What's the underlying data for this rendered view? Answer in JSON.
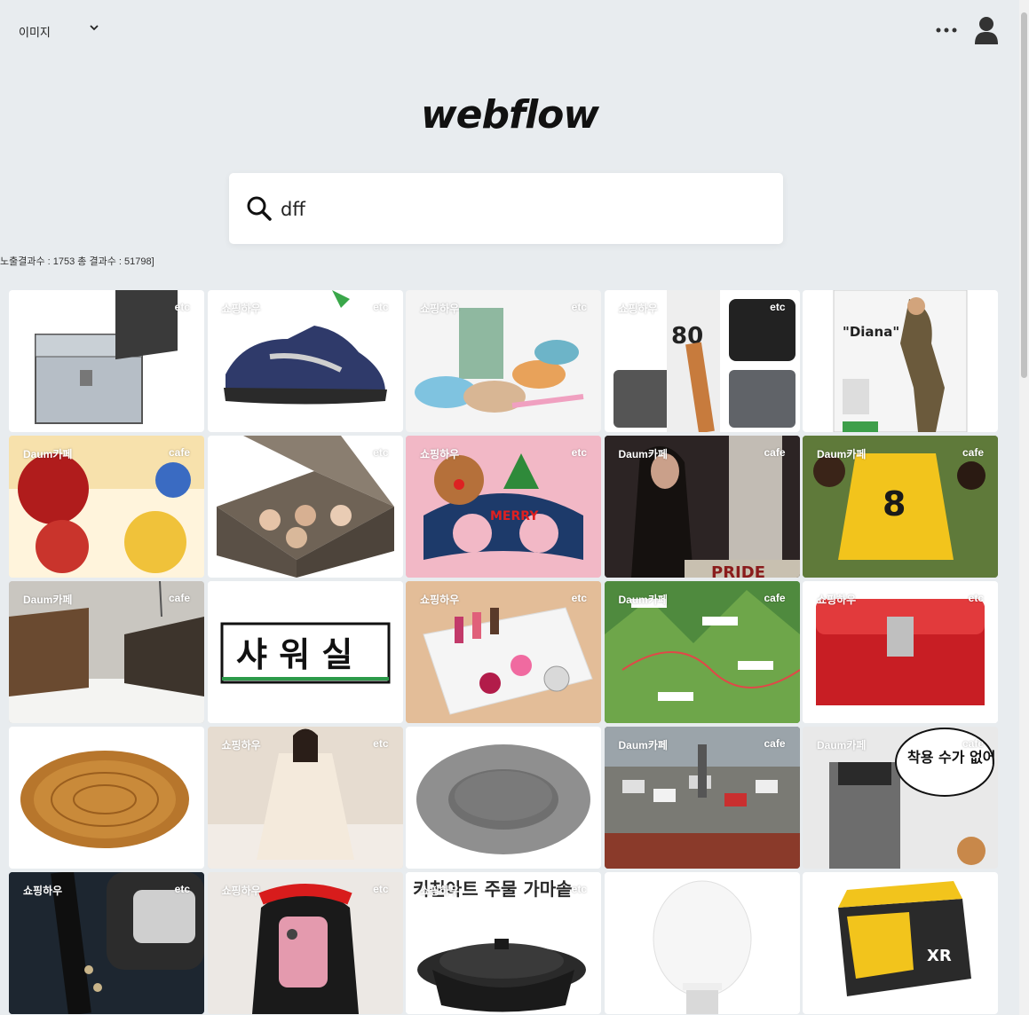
{
  "header": {
    "type_selector": "이미지",
    "more_label": "•••"
  },
  "logo": "webflow",
  "search": {
    "value": "dff"
  },
  "result_count": "노출결과수 : 1753 총 결과수 : 51798]",
  "results": [
    {
      "source": "",
      "type": "etc",
      "icon": "aluminum-case",
      "bg": "#ffffff"
    },
    {
      "source": "쇼핑하우",
      "type": "etc",
      "icon": "sneaker",
      "bg": "#ffffff"
    },
    {
      "source": "쇼핑하우",
      "type": "etc",
      "icon": "bowls",
      "bg": "#f4f4f4"
    },
    {
      "source": "쇼핑하우",
      "type": "etc",
      "icon": "bags",
      "bg": "#ffffff"
    },
    {
      "source": "",
      "type": "",
      "icon": "figure-diana",
      "bg": "#ffffff"
    },
    {
      "source": "Daum카페",
      "type": "cafe",
      "icon": "pouches",
      "bg": "#fff4dc"
    },
    {
      "source": "",
      "type": "etc",
      "icon": "storage-box",
      "bg": "#ffffff"
    },
    {
      "source": "쇼핑하우",
      "type": "etc",
      "icon": "christmas-glasses",
      "bg": "#f2b8c6"
    },
    {
      "source": "Daum카페",
      "type": "cafe",
      "icon": "fashion-photo",
      "bg": "#2c2424"
    },
    {
      "source": "Daum카페",
      "type": "cafe",
      "icon": "football",
      "bg": "#5f7a3a"
    },
    {
      "source": "Daum카페",
      "type": "cafe",
      "icon": "snow-village",
      "bg": "#c9c6c0"
    },
    {
      "source": "",
      "type": "",
      "icon": "shower-sign",
      "bg": "#ffffff"
    },
    {
      "source": "쇼핑하우",
      "type": "etc",
      "icon": "cosmetic-organizer",
      "bg": "#e3bd98"
    },
    {
      "source": "Daum카페",
      "type": "cafe",
      "icon": "mountain-map",
      "bg": "#4f8a3e"
    },
    {
      "source": "쇼핑하우",
      "type": "etc",
      "icon": "red-case",
      "bg": "#ffffff"
    },
    {
      "source": "",
      "type": "",
      "icon": "rattan-mat",
      "bg": "#ffffff"
    },
    {
      "source": "쇼핑하우",
      "type": "etc",
      "icon": "dress-photo",
      "bg": "#e6dcd0"
    },
    {
      "source": "",
      "type": "",
      "icon": "pet-bed",
      "bg": "#ffffff"
    },
    {
      "source": "Daum카페",
      "type": "cafe",
      "icon": "traffic-jam",
      "bg": "#7a7a74"
    },
    {
      "source": "Daum카페",
      "type": "cafe",
      "icon": "cartoon",
      "bg": "#e9e9e9"
    },
    {
      "source": "쇼핑하우",
      "type": "etc",
      "icon": "car-key",
      "bg": "#1d2630"
    },
    {
      "source": "쇼핑하우",
      "type": "etc",
      "icon": "selfie",
      "bg": "#ece8e4"
    },
    {
      "source": "쇼핑하우",
      "type": "etc",
      "icon": "pot",
      "bg": "#ffffff"
    },
    {
      "source": "",
      "type": "",
      "icon": "light-bulb",
      "bg": "#ffffff"
    },
    {
      "source": "",
      "type": "",
      "icon": "battery",
      "bg": "#ffffff"
    }
  ],
  "image_text": {
    "figure_title": "\"Diana\"",
    "shower_sign": "샤 워 실",
    "pot_banner": "키친아트 주물 가마솥",
    "cartoon_bubble": "착용 수가 없어"
  }
}
